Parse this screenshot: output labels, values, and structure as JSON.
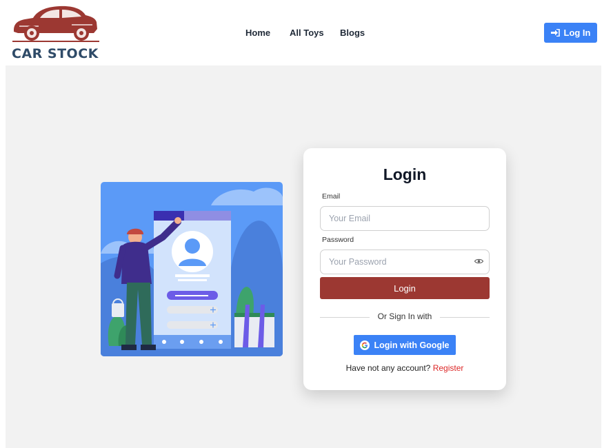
{
  "header": {
    "logo_text": "CAR STOCK",
    "nav": [
      {
        "label": "Home"
      },
      {
        "label": "All Toys"
      },
      {
        "label": "Blogs"
      }
    ],
    "login_button": "Log In"
  },
  "login_card": {
    "title": "Login",
    "email_label": "Email",
    "email_placeholder": "Your Email",
    "password_label": "Password",
    "password_placeholder": "Your Password",
    "submit_label": "Login",
    "divider_text": "Or Sign In with",
    "google_button": "Login with Google",
    "no_account_text": "Have not any account?",
    "register_link": "Register"
  },
  "colors": {
    "brand_red": "#9c3832",
    "primary_blue": "#3b82f6",
    "logo_navy": "#2f4b68",
    "register_red": "#dc2626",
    "page_bg": "#f2f2f2"
  },
  "icons": [
    "car-logo-icon",
    "sign-in-icon",
    "eye-icon",
    "google-icon"
  ]
}
